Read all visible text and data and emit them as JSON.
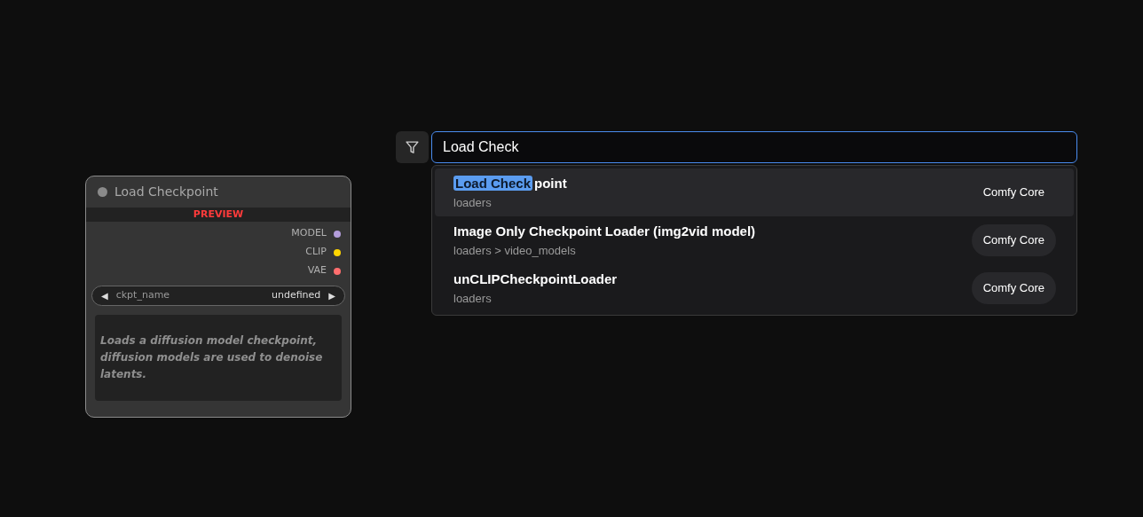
{
  "node": {
    "title": "Load Checkpoint",
    "badge": "PREVIEW",
    "outputs": [
      {
        "label": "MODEL",
        "color": "#b39ddb"
      },
      {
        "label": "CLIP",
        "color": "#ffd500"
      },
      {
        "label": "VAE",
        "color": "#ff6e6e"
      }
    ],
    "widget": {
      "name": "ckpt_name",
      "value": "undefined",
      "prev": "◀",
      "next": "▶"
    },
    "description": "Loads a diffusion model checkpoint, diffusion models are used to denoise latents."
  },
  "search": {
    "value": "Load Check",
    "results": [
      {
        "title_parts": [
          {
            "text": "Load Check",
            "highlighted": true
          },
          {
            "text": "point",
            "highlighted": false
          }
        ],
        "category": "loaders",
        "source": "Comfy Core",
        "selected": true
      },
      {
        "title_parts": [
          {
            "text": "Image Only Checkpoint Loader (img2vid model)",
            "highlighted": false
          }
        ],
        "category": "loaders > video_models",
        "source": "Comfy Core",
        "selected": false
      },
      {
        "title_parts": [
          {
            "text": "unCLIPCheckpointLoader",
            "highlighted": false
          }
        ],
        "category": "loaders",
        "source": "Comfy Core",
        "selected": false
      }
    ]
  }
}
